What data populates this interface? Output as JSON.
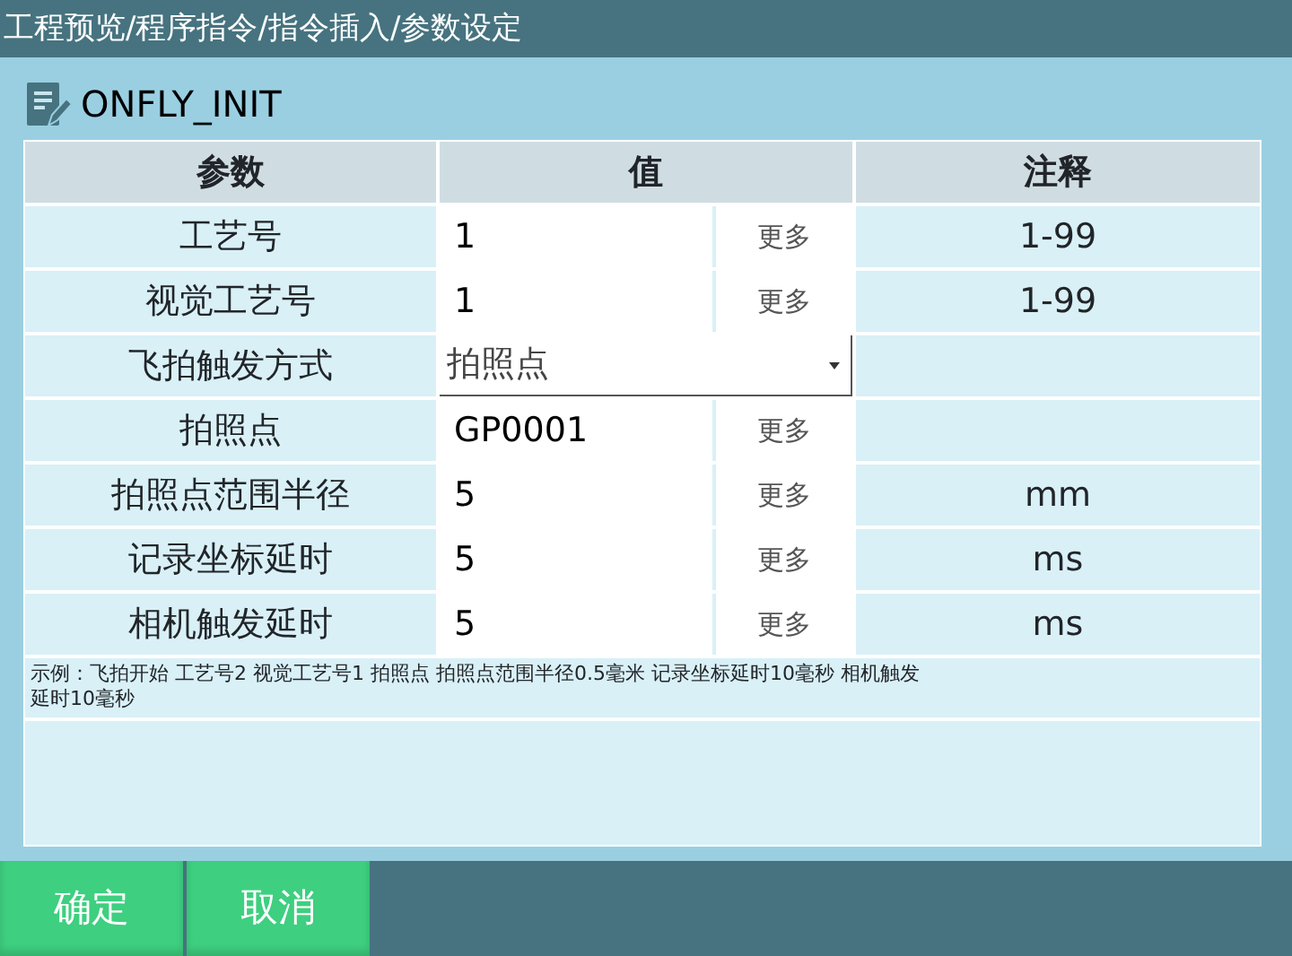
{
  "window": {
    "title": "工程预览/程序指令/指令插入/参数设定"
  },
  "command": {
    "name": "ONFLY_INIT"
  },
  "table": {
    "columns": [
      "参数",
      "值",
      "注释"
    ],
    "rows": [
      {
        "kind": "input",
        "param": "工艺号",
        "value": "1",
        "button": "更多",
        "note": "1-99"
      },
      {
        "kind": "input",
        "param": "视觉工艺号",
        "value": "1",
        "button": "更多",
        "note": "1-99"
      },
      {
        "kind": "select",
        "param": "飞拍触发方式",
        "value": "拍照点"
      },
      {
        "kind": "input",
        "param": "拍照点",
        "value": "GP0001",
        "button": "更多"
      },
      {
        "kind": "input",
        "param": "拍照点范围半径",
        "value": "5",
        "button": "更多",
        "note": "mm"
      },
      {
        "kind": "input",
        "param": "记录坐标延时",
        "value": "5",
        "button": "更多",
        "note": "ms"
      },
      {
        "kind": "input",
        "param": "相机触发延时",
        "value": "5",
        "button": "更多",
        "note": "ms"
      }
    ]
  },
  "example": "示例：飞拍开始 工艺号2 视觉工艺号1 拍照点 拍照点范围半径0.5毫米 记录坐标延时10毫秒 相机触发延时10毫秒",
  "buttons": [
    "确定",
    "取消"
  ]
}
